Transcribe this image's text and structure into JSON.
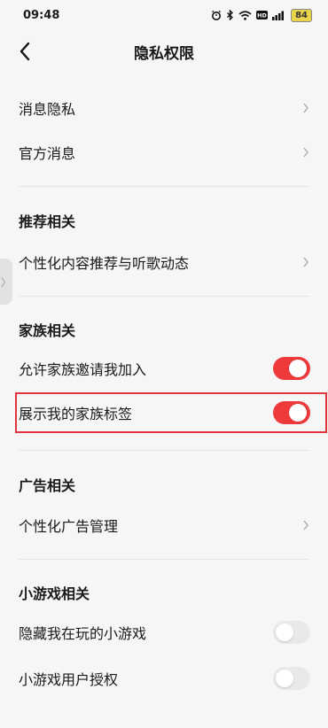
{
  "status_bar": {
    "time": "09:48",
    "battery": "84",
    "icons": [
      "alarm-icon",
      "bluetooth-icon",
      "wifi-icon",
      "hd-icon",
      "signal-icon"
    ]
  },
  "nav": {
    "title": "隐私权限",
    "back_icon": "back-arrow-icon"
  },
  "items": {
    "message_privacy": "消息隐私",
    "official_message": "官方消息",
    "recommend_section": "推荐相关",
    "personalized_content": "个性化内容推荐与听歌动态",
    "family_section": "家族相关",
    "allow_family_invite": {
      "label": "允许家族邀请我加入",
      "enabled": true
    },
    "show_family_tag": {
      "label": "展示我的家族标签",
      "enabled": true
    },
    "ad_section": "广告相关",
    "personalized_ads": "个性化广告管理",
    "minigame_section": "小游戏相关",
    "hide_playing_minigames": {
      "label": "隐藏我在玩的小游戏",
      "enabled": false
    },
    "minigame_user_auth": {
      "label": "小游戏用户授权",
      "enabled": false
    }
  },
  "colors": {
    "accent": "#ee3a3a",
    "highlight_border": "#e0353c",
    "background": "#f6f6f6"
  },
  "side_handle_glyph": "〉"
}
